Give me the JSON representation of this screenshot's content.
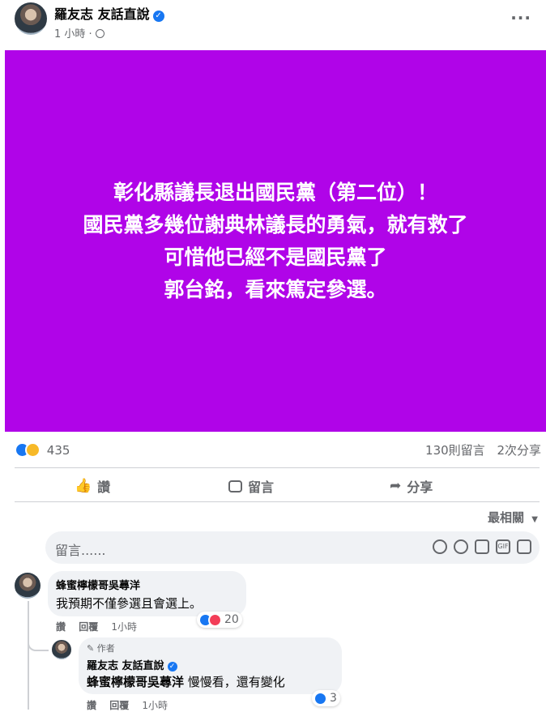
{
  "post": {
    "author": "羅友志 友話直說",
    "time": "1 小時 ·",
    "lines": [
      "彰化縣議長退出國民黨（第二位）！",
      "國民黨多幾位謝典林議長的勇氣，就有救了",
      "可惜他已經不是國民黨了",
      "郭台銘，看來篤定參選。"
    ],
    "background_color": "#b004e8",
    "more_icon": "more-options-icon"
  },
  "stats": {
    "reactions_count": "435",
    "comments": "130則留言",
    "shares": "2次分享"
  },
  "actions": {
    "like": "讚",
    "comment": "留言",
    "share": "分享"
  },
  "sort": {
    "label": "最相關"
  },
  "composer": {
    "placeholder": "留言......"
  },
  "comments": [
    {
      "name": "蜂蜜檸檬哥吳蕁洋",
      "text": "我預期不僅參選且會選上。",
      "like": "讚",
      "reply": "回覆",
      "time": "1小時",
      "reactions": "20"
    }
  ],
  "reply": {
    "badge": "作者",
    "name": "羅友志 友話直說",
    "mention": "蜂蜜檸檬哥吳蕁洋",
    "text": " 慢慢看，還有變化",
    "like": "讚",
    "reply": "回覆",
    "time": "1小時",
    "reactions": "3"
  }
}
